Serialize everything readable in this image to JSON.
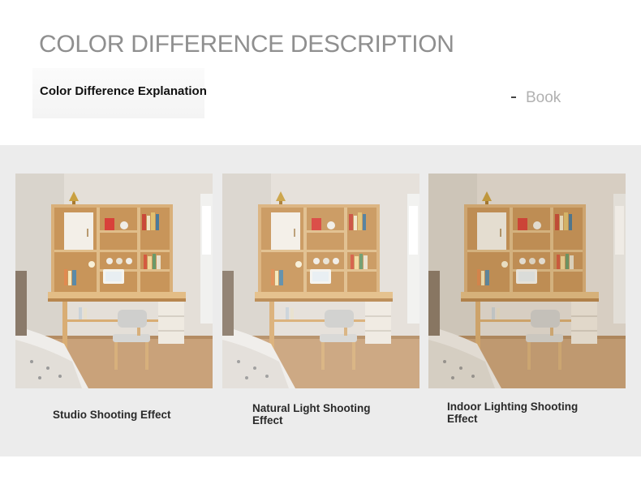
{
  "header": {
    "title": "COLOR DIFFERENCE DESCRIPTION",
    "subtitle": "Color Difference Explanation",
    "book_label": "Book"
  },
  "cards": [
    {
      "caption": "Studio Shooting Effect",
      "tint": "#ffffff",
      "tint_opacity": 0.0
    },
    {
      "caption": "Natural Light Shooting Effect",
      "tint": "#ffffff",
      "tint_opacity": 0.08
    },
    {
      "caption": "Indoor Lighting Shooting Effect",
      "tint": "#7a5a2a",
      "tint_opacity": 0.12
    }
  ]
}
